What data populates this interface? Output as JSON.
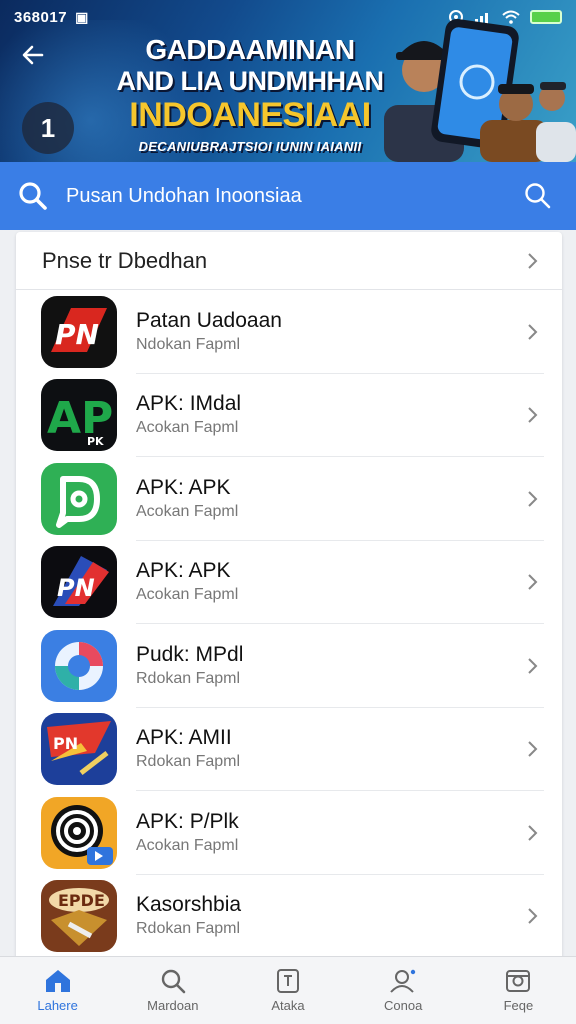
{
  "status_bar": {
    "time": "368017"
  },
  "banner": {
    "title_line1": "GADDAAMINAN",
    "title_line2": "AND LIA UNDMHHAN",
    "title_line3": "INDOANESIAAI",
    "title_line4": "DECANIUBRAJTSIOI IUNIN IAIANII",
    "badge": "1"
  },
  "search": {
    "text": "Pusan Undohan Inoonsiaa"
  },
  "section": {
    "title": "Pnse tr Dbedhan"
  },
  "apps": [
    {
      "name": "Patan Uadoaan",
      "sub": "Ndokan Fapml",
      "icon": "pn-logo-icon"
    },
    {
      "name": "APK: IMdal",
      "sub": "Acokan Fapml",
      "icon": "ap-logo-icon"
    },
    {
      "name": "APK: APK",
      "sub": "Acokan Fapml",
      "icon": "green-d-icon"
    },
    {
      "name": "APK: APK",
      "sub": "Acokan Fapml",
      "icon": "pn-flag-icon"
    },
    {
      "name": "Pudk: MPdl",
      "sub": "Rdokan Fapml",
      "icon": "circle-swirl-icon"
    },
    {
      "name": "APK: AMII",
      "sub": "Rdokan Fapml",
      "icon": "flag-sword-icon"
    },
    {
      "name": "APK: P/Plk",
      "sub": "Acokan Fapml",
      "icon": "spiral-icon"
    },
    {
      "name": "Kasorshbia",
      "sub": "Rdokan Fapml",
      "icon": "game-box-icon"
    }
  ],
  "bottom_nav": [
    {
      "label": "Lahere",
      "icon": "home-icon",
      "active": true
    },
    {
      "label": "Mardoan",
      "icon": "search-icon",
      "active": false
    },
    {
      "label": "Ataka",
      "icon": "document-icon",
      "active": false
    },
    {
      "label": "Conoa",
      "icon": "profile-icon",
      "active": false
    },
    {
      "label": "Feqe",
      "icon": "gallery-icon",
      "active": false
    }
  ],
  "colors": {
    "accent": "#3a7ee6",
    "nav_active": "#2f74dd",
    "banner_highlight": "#f6c62c"
  }
}
